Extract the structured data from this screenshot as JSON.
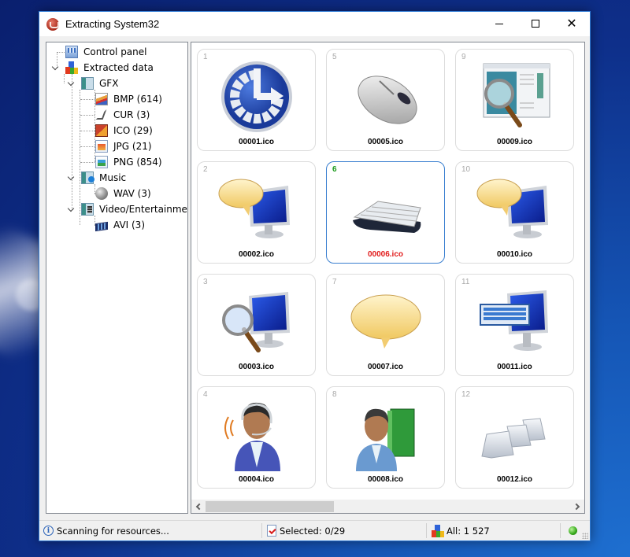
{
  "window": {
    "title": "Extracting System32",
    "controls": {
      "minimize": "minimize",
      "maximize": "maximize",
      "close": "close"
    }
  },
  "tree": {
    "items": [
      {
        "label": "Control panel",
        "icon": "control-panel-icon",
        "level": 0,
        "expanded": null
      },
      {
        "label": "Extracted data",
        "icon": "blocks-icon",
        "level": 0,
        "expanded": true
      },
      {
        "label": "GFX",
        "icon": "graphics-folder-icon",
        "level": 1,
        "expanded": true
      },
      {
        "label": "BMP (614)",
        "icon": "bmp-icon",
        "level": 2,
        "expanded": null
      },
      {
        "label": "CUR (3)",
        "icon": "cursor-icon",
        "level": 2,
        "expanded": null
      },
      {
        "label": "ICO (29)",
        "icon": "ico-icon",
        "level": 2,
        "expanded": null
      },
      {
        "label": "JPG (21)",
        "icon": "jpg-icon",
        "level": 2,
        "expanded": null
      },
      {
        "label": "PNG (854)",
        "icon": "png-icon",
        "level": 2,
        "expanded": null
      },
      {
        "label": "Music",
        "icon": "music-folder-icon",
        "level": 1,
        "expanded": true
      },
      {
        "label": "WAV (3)",
        "icon": "speaker-icon",
        "level": 2,
        "expanded": null
      },
      {
        "label": "Video/Entertainment",
        "icon": "video-folder-icon",
        "level": 1,
        "expanded": true
      },
      {
        "label": "AVI (3)",
        "icon": "film-icon",
        "level": 2,
        "expanded": null
      }
    ]
  },
  "grid": {
    "selected_index": 6,
    "tiles": [
      {
        "num": "1",
        "name": "00001.ico",
        "icon": "ease-of-access-icon"
      },
      {
        "num": "2",
        "name": "00002.ico",
        "icon": "monitor-speech-bubble-icon"
      },
      {
        "num": "3",
        "name": "00003.ico",
        "icon": "monitor-magnifier-icon"
      },
      {
        "num": "4",
        "name": "00004.ico",
        "icon": "headset-user-icon"
      },
      {
        "num": "5",
        "name": "00005.ico",
        "icon": "mouse-icon"
      },
      {
        "num": "6",
        "name": "00006.ico",
        "icon": "keyboard-icon"
      },
      {
        "num": "7",
        "name": "00007.ico",
        "icon": "speech-bubble-icon"
      },
      {
        "num": "8",
        "name": "00008.ico",
        "icon": "user-book-icon"
      },
      {
        "num": "9",
        "name": "00009.ico",
        "icon": "window-magnifier-icon"
      },
      {
        "num": "10",
        "name": "00010.ico",
        "icon": "monitor-speech-bubble-icon"
      },
      {
        "num": "11",
        "name": "00011.ico",
        "icon": "monitor-keyboard-icon"
      },
      {
        "num": "12",
        "name": "00012.ico",
        "icon": "keycaps-icon"
      }
    ]
  },
  "scrollbar": {
    "horizontal_position": 0.0,
    "visible_fraction": 0.35
  },
  "status": {
    "message": "Scanning for resources...",
    "selected": "Selected: 0/29",
    "all": "All: 1 527",
    "indicator_color": "#35a81a"
  }
}
